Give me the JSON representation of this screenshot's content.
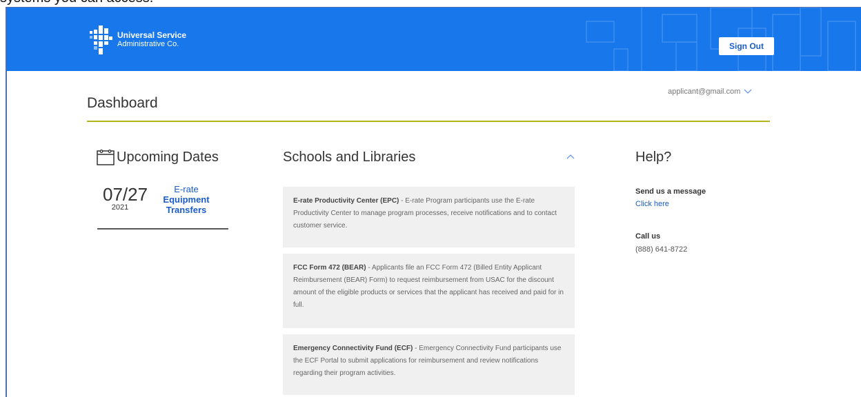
{
  "top_cut_text": "systems you can access.",
  "header": {
    "logo_line1": "Universal Service",
    "logo_line2": "Administrative Co.",
    "signout_label": "Sign Out",
    "colors": {
      "header_bg": "#1877ea",
      "link": "#1a5cc8",
      "accent_rule": "#b5b51d"
    }
  },
  "user": {
    "email": "applicant@gmail.com",
    "icon": "chevron-down-icon"
  },
  "page_title": "Dashboard",
  "upcoming": {
    "heading": "Upcoming Dates",
    "icon": "calendar-icon",
    "items": [
      {
        "month_day": "07/27",
        "year": "2021",
        "line1": "E-rate",
        "line2": "Equipment",
        "line3": "Transfers"
      }
    ]
  },
  "schools": {
    "heading": "Schools and Libraries",
    "cards": [
      {
        "title": "E-rate Productivity Center (EPC)",
        "text": " - E-rate Program participants use the E-rate Productivity Center to manage program processes, receive notifications and to contact customer service."
      },
      {
        "title": "FCC Form 472 (BEAR)",
        "text": " - Applicants file an FCC Form 472 (Billed Entity Applicant Reimbursement (BEAR) Form) to request reimbursement from USAC for the discount amount of the eligible products or services that the applicant has received and paid for in full."
      },
      {
        "title": "Emergency Connectivity Fund (ECF)",
        "text": " - Emergency Connectivity Fund participants use the ECF Portal to submit applications for reimbursement and review notifications regarding their program activities."
      }
    ]
  },
  "help": {
    "heading": "Help?",
    "message_label": "Send us a message",
    "message_link": "Click here",
    "call_label": "Call us",
    "phone": "(888) 641-8722"
  }
}
